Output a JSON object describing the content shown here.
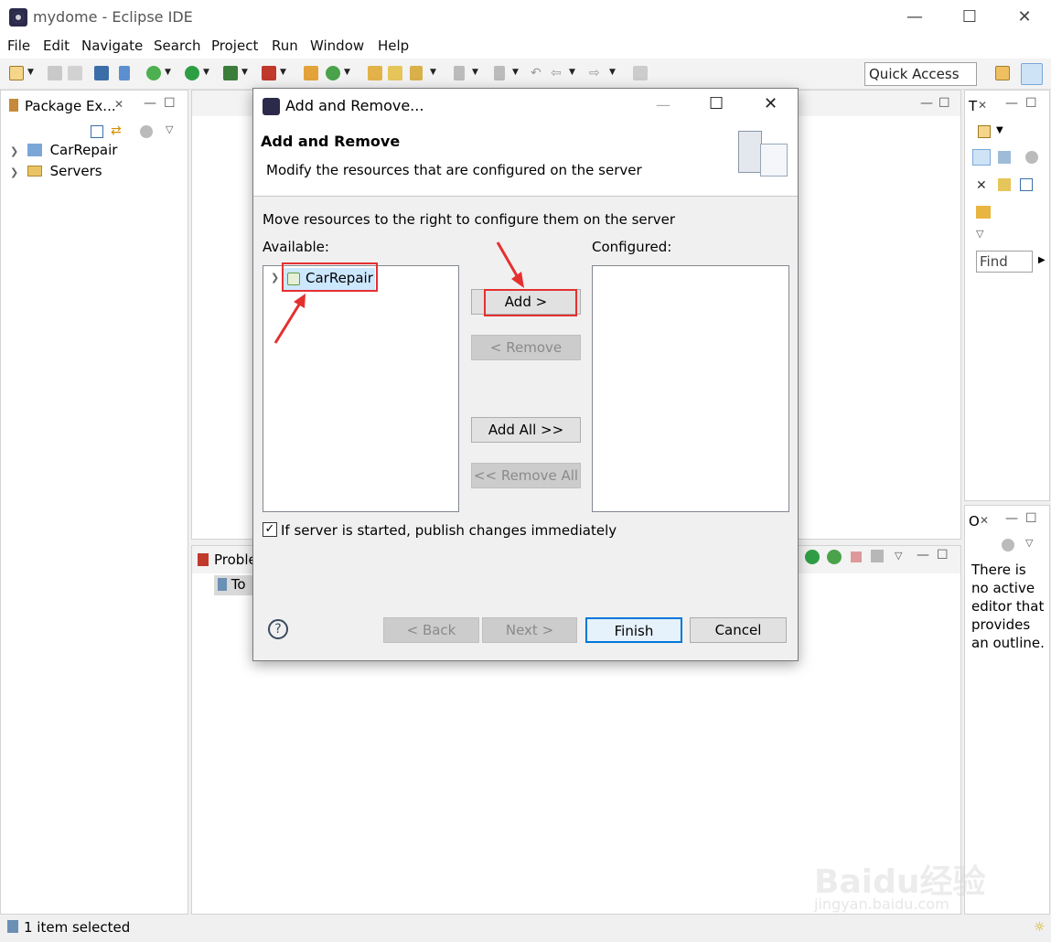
{
  "window": {
    "title": "mydome - Eclipse IDE"
  },
  "menu": [
    "File",
    "Edit",
    "Navigate",
    "Search",
    "Project",
    "Run",
    "Window",
    "Help"
  ],
  "toolbar": {
    "quick_access": "Quick Access"
  },
  "package_explorer": {
    "tab_label": "Package Ex...",
    "items": [
      {
        "label": "CarRepair",
        "icon": "java-project-icon"
      },
      {
        "label": "Servers",
        "icon": "folder-icon"
      }
    ]
  },
  "right_top_panel": {
    "tab_label": "T",
    "find_placeholder": "Find"
  },
  "outline_panel": {
    "tab_label": "O",
    "message": "There is no active editor that provides an outline."
  },
  "bottom_panel": {
    "tab_label": "Proble",
    "row_label": "To"
  },
  "dialog": {
    "title": "Add and Remove...",
    "header_title": "Add and Remove",
    "header_description": "Modify the resources that are configured on the server",
    "instruction": "Move resources to the right to configure them on the server",
    "available_label": "Available:",
    "configured_label": "Configured:",
    "available_items": [
      "CarRepair"
    ],
    "configured_items": [],
    "buttons": {
      "add": "Add >",
      "remove": "< Remove",
      "add_all": "Add All >>",
      "remove_all": "<< Remove All",
      "back": "< Back",
      "next": "Next >",
      "finish": "Finish",
      "cancel": "Cancel"
    },
    "publish_checkbox": {
      "label": "If server is started, publish changes immediately",
      "checked": true
    }
  },
  "status": {
    "text": "1 item selected"
  },
  "watermark": {
    "brand": "Baidu经验",
    "url": "jingyan.baidu.com"
  },
  "colors": {
    "annotation_red": "#e53030",
    "selection_blue": "#cce8ff",
    "finish_border": "#0078d7"
  }
}
